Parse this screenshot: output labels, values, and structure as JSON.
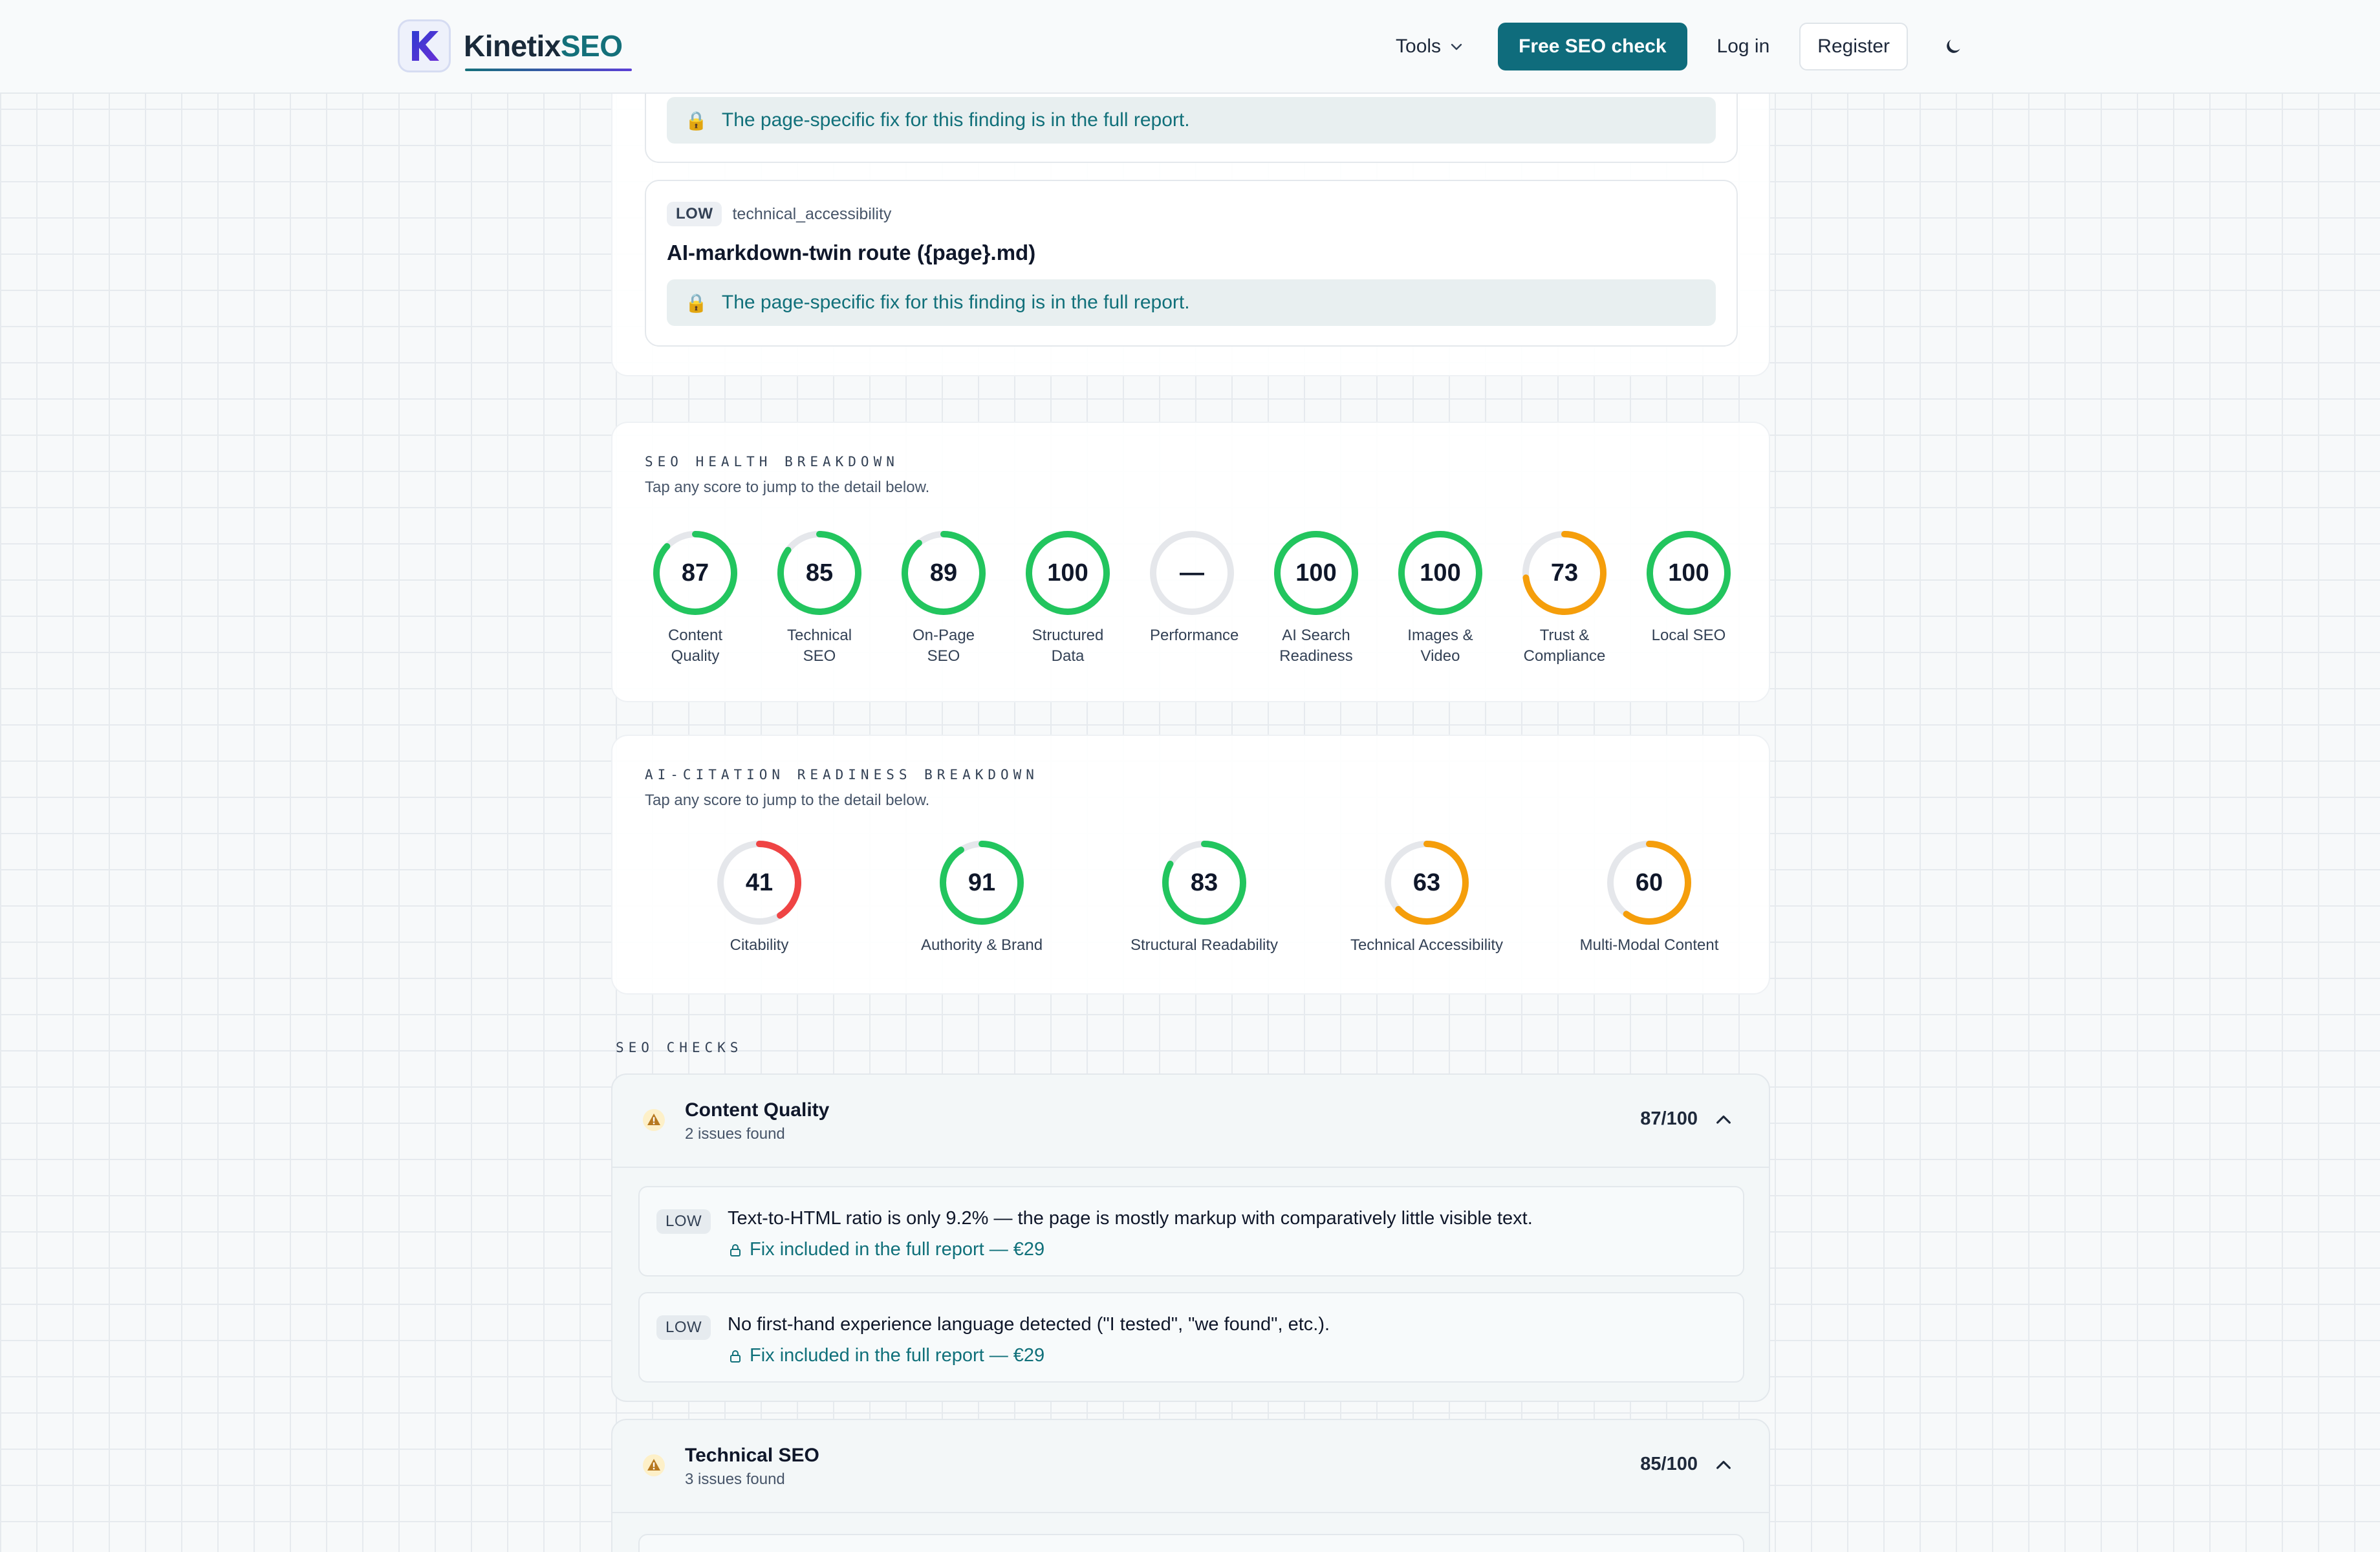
{
  "brand": {
    "name_part1": "Kinetix",
    "name_part2": "SEO",
    "logo_letter": "K"
  },
  "nav": {
    "tools_label": "Tools",
    "cta_label": "Free SEO check",
    "login_label": "Log in",
    "register_label": "Register"
  },
  "findings": {
    "first": {
      "lock_note": "The page-specific fix for this finding is in the full report."
    },
    "second": {
      "severity": "LOW",
      "category": "technical_accessibility",
      "title": "AI-markdown-twin route ({page}.md)",
      "lock_note": "The page-specific fix for this finding is in the full report."
    }
  },
  "seo_health": {
    "label": "SEO HEALTH BREAKDOWN",
    "subtitle": "Tap any score to jump to the detail below.",
    "scores": [
      {
        "label": "Content Quality",
        "display": "87",
        "value": 87,
        "color": "#22c55e"
      },
      {
        "label": "Technical SEO",
        "display": "85",
        "value": 85,
        "color": "#22c55e"
      },
      {
        "label": "On-Page SEO",
        "display": "89",
        "value": 89,
        "color": "#22c55e"
      },
      {
        "label": "Structured Data",
        "display": "100",
        "value": 100,
        "color": "#22c55e"
      },
      {
        "label": "Performance",
        "display": "—",
        "value": 0,
        "color": "#22c55e"
      },
      {
        "label": "AI Search Readiness",
        "display": "100",
        "value": 100,
        "color": "#22c55e"
      },
      {
        "label": "Images & Video",
        "display": "100",
        "value": 100,
        "color": "#22c55e"
      },
      {
        "label": "Trust & Compliance",
        "display": "73",
        "value": 73,
        "color": "#f59e0b"
      },
      {
        "label": "Local SEO",
        "display": "100",
        "value": 100,
        "color": "#22c55e"
      }
    ]
  },
  "ai_citation": {
    "label": "AI-CITATION READINESS BREAKDOWN",
    "subtitle": "Tap any score to jump to the detail below.",
    "scores": [
      {
        "label": "Citability",
        "display": "41",
        "value": 41,
        "color": "#ef4444"
      },
      {
        "label": "Authority & Brand",
        "display": "91",
        "value": 91,
        "color": "#22c55e"
      },
      {
        "label": "Structural Readability",
        "display": "83",
        "value": 83,
        "color": "#22c55e"
      },
      {
        "label": "Technical Accessibility",
        "display": "63",
        "value": 63,
        "color": "#f59e0b"
      },
      {
        "label": "Multi-Modal Content",
        "display": "60",
        "value": 60,
        "color": "#f59e0b"
      }
    ]
  },
  "seo_checks": {
    "label": "SEO CHECKS",
    "groups": [
      {
        "title": "Content Quality",
        "subtitle": "2 issues found",
        "score": "87/100",
        "issues": [
          {
            "severity": "LOW",
            "text": "Text-to-HTML ratio is only 9.2% — the page is mostly markup with comparatively little visible text.",
            "fix": "Fix included in the full report — €29"
          },
          {
            "severity": "LOW",
            "text": "No first-hand experience language detected (\"I tested\", \"we found\", etc.).",
            "fix": "Fix included in the full report — €29"
          }
        ]
      },
      {
        "title": "Technical SEO",
        "subtitle": "3 issues found",
        "score": "85/100"
      }
    ]
  },
  "colors": {
    "accent": "#0f6c7c",
    "good": "#22c55e",
    "warn": "#f59e0b",
    "bad": "#ef4444",
    "track": "#e5e7eb"
  }
}
